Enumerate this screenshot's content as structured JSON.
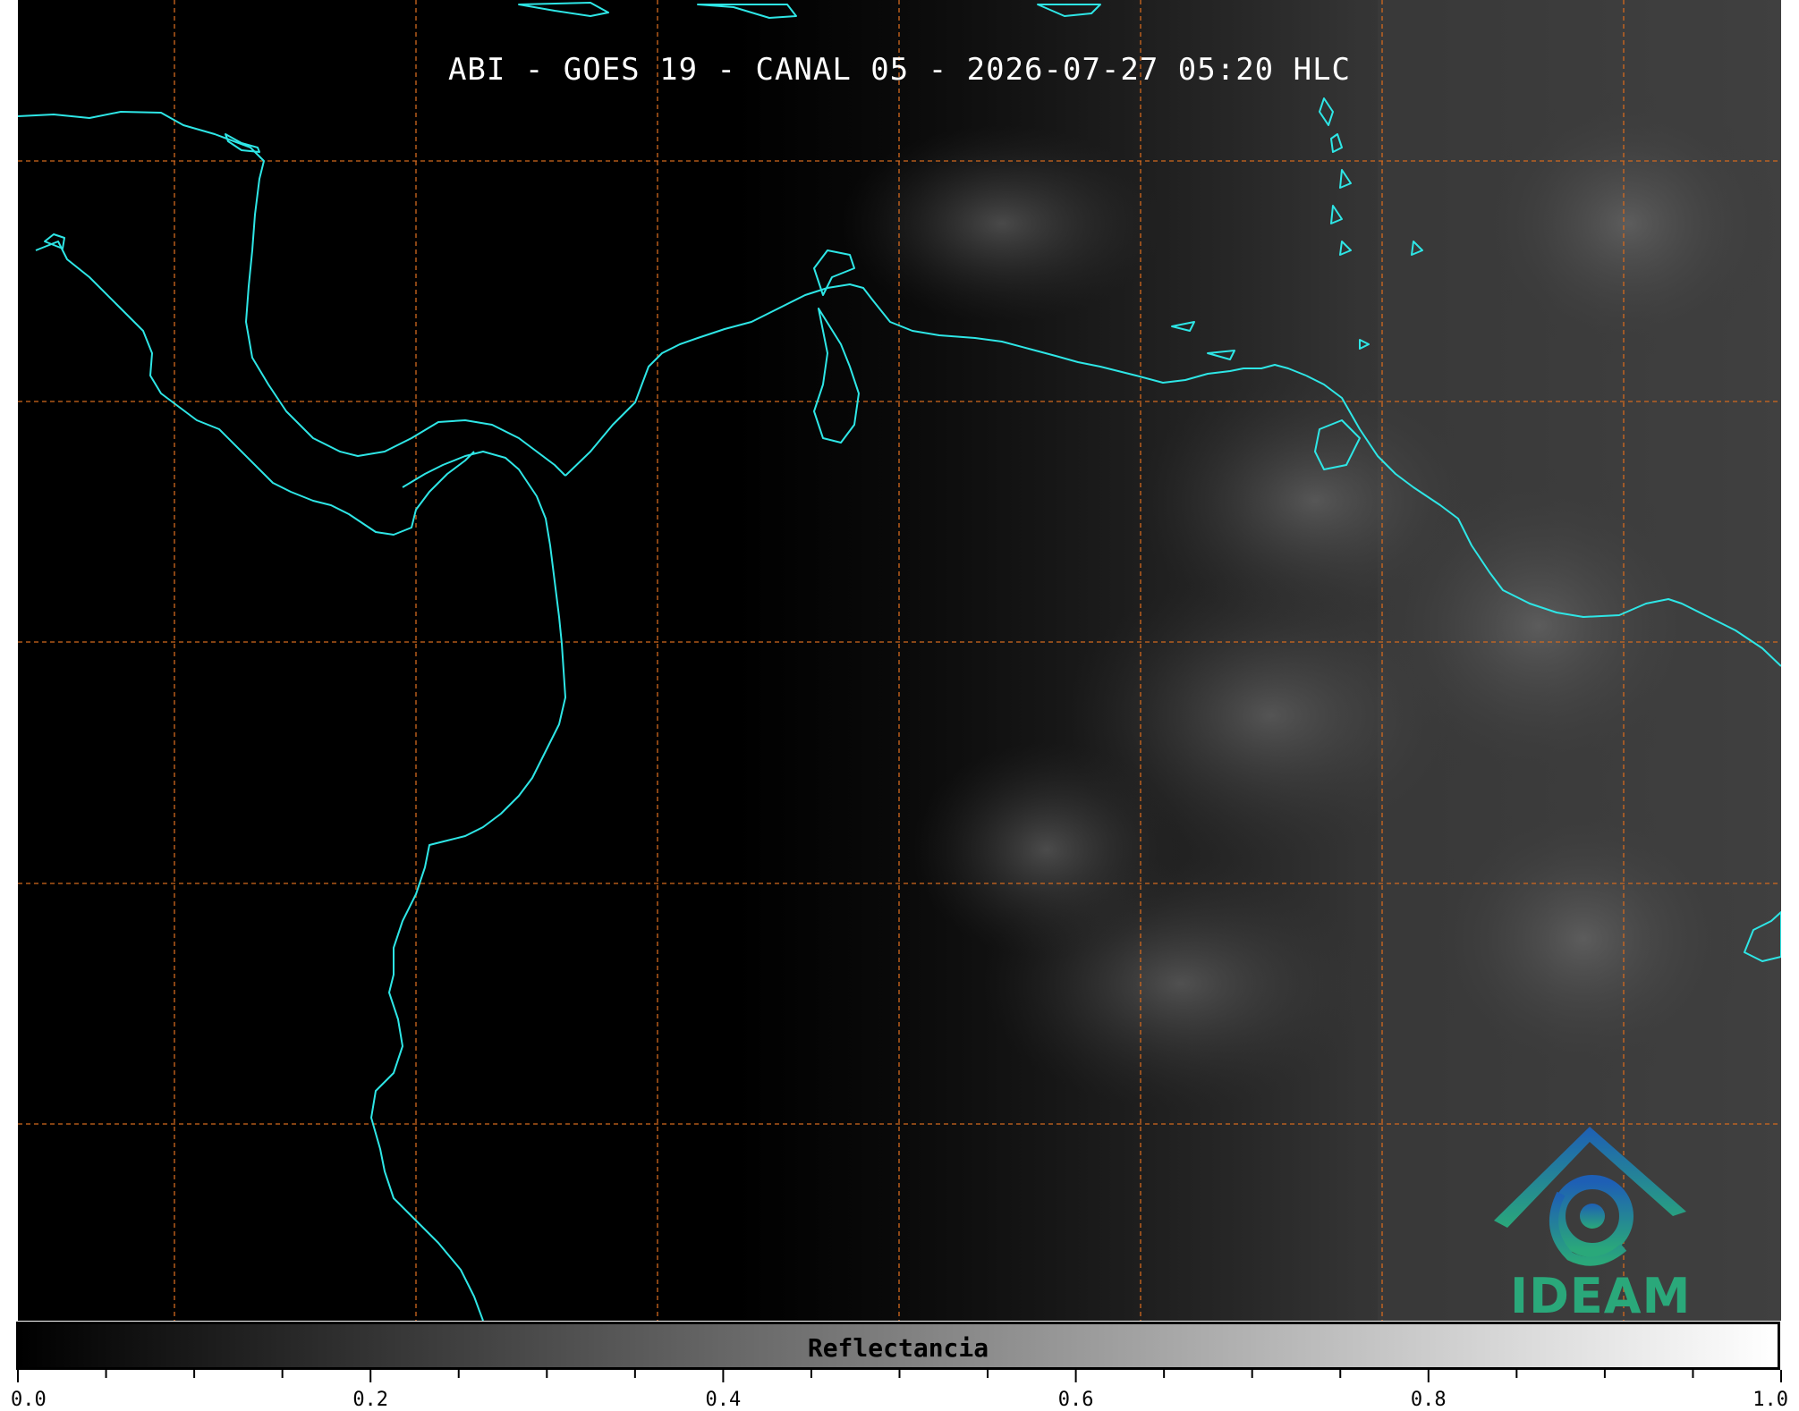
{
  "title": "ABI - GOES 19 - CANAL 05 - 2026-07-27 05:20 HLC",
  "colorbar": {
    "label": "Reflectancia",
    "ticks": [
      "0.0",
      "0.2",
      "0.4",
      "0.6",
      "0.8",
      "1.0"
    ],
    "min": 0.0,
    "max": 1.0
  },
  "logo": {
    "text": "IDEAM"
  },
  "colors": {
    "coastline": "#2ee6e6",
    "gridlines": "#d2691e",
    "background": "#000000",
    "logo_text": "#2aa87a"
  },
  "map": {
    "gridlines": true,
    "coastlines": true
  }
}
